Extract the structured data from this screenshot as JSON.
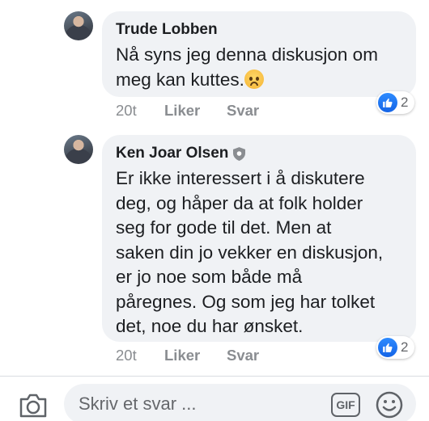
{
  "comments": [
    {
      "author": "Trude Lobben",
      "lines": [
        "Nå syns jeg denna diskusjon om",
        "meg kan kuttes."
      ],
      "emoji": "frowning-face",
      "time": "20t",
      "like_label": "Liker",
      "reply_label": "Svar",
      "reaction_count": "2"
    },
    {
      "author": "Ken Joar Olsen",
      "verified_badge": "shield-icon",
      "lines": [
        "Er ikke interessert i å diskutere",
        "deg, og håper da at folk holder",
        "seg for gode til det. Men at",
        "saken din jo vekker en diskusjon,",
        "er jo noe som både må",
        "påregnes. Og som jeg har tolket",
        "det, noe du har ønsket."
      ],
      "time": "20t",
      "like_label": "Liker",
      "reply_label": "Svar",
      "reaction_count": "2"
    }
  ],
  "composer": {
    "placeholder": "Skriv et svar ...",
    "gif_label": "GIF",
    "camera_icon": "camera-icon",
    "emoji_icon": "smiley-icon"
  },
  "colors": {
    "bubble": "#f0f2f5",
    "like_blue": "#1877f2",
    "meta_gray": "#8a8d91"
  }
}
